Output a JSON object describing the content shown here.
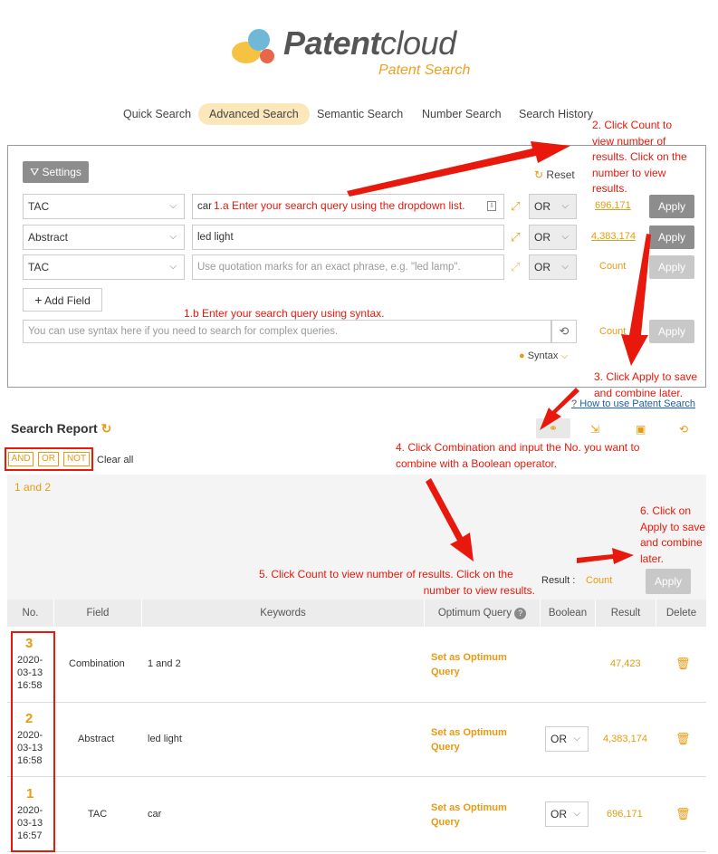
{
  "brand": {
    "name_bold": "Patent",
    "name_thin": "cloud",
    "subtitle": "Patent Search"
  },
  "tabs": [
    {
      "label": "Quick Search"
    },
    {
      "label": "Advanced Search"
    },
    {
      "label": "Semantic Search"
    },
    {
      "label": "Number Search"
    },
    {
      "label": "Search History"
    }
  ],
  "search": {
    "settings_label": "Settings",
    "reset_label": "Reset",
    "rows": [
      {
        "field": "TAC",
        "value": "car",
        "placeholder": "",
        "operator": "OR",
        "count": "696,171",
        "apply": "Apply"
      },
      {
        "field": "Abstract",
        "value": "led light",
        "placeholder": "",
        "operator": "OR",
        "count": "4,383,174",
        "apply": "Apply"
      },
      {
        "field": "TAC",
        "value": "",
        "placeholder": "Use quotation marks for an exact phrase, e.g. \"led lamp\".",
        "operator": "OR",
        "count": "Count",
        "apply": "Apply"
      }
    ],
    "add_field_label": "Add Field",
    "syntax_placeholder": "You can use syntax here if you need to search for complex queries.",
    "syntax_count": "Count",
    "syntax_apply": "Apply",
    "syntax_label": "Syntax",
    "help_link": "How to use Patent Search"
  },
  "annotations": {
    "a1": "1.a Enter your search query using the dropdown list.",
    "a1b": "1.b Enter your search query using syntax.",
    "a2": [
      "2. Click Count to",
      "view number of",
      "results. Click on the",
      "number to view",
      "results."
    ],
    "a3": [
      "3. Click Apply to save",
      "and combine later."
    ],
    "a4": [
      "4. Click Combination and input the No. you want to",
      "combine with a Boolean operator."
    ],
    "a5": [
      "5. Click Count to view number of results. Click on the",
      "number to view results."
    ],
    "a6": [
      "6. Click on",
      "Apply to save",
      "and combine",
      "later."
    ]
  },
  "report": {
    "title": "Search Report",
    "ops": [
      "AND",
      "OR",
      "NOT"
    ],
    "clear_all": "Clear all",
    "combination_text": "1 and 2",
    "result_label": "Result :",
    "result_count": "Count",
    "apply": "Apply",
    "columns": [
      "No.",
      "Field",
      "Keywords",
      "Optimum Query",
      "Boolean",
      "Result",
      "Delete"
    ],
    "rows": [
      {
        "no": "3",
        "date": "2020-",
        "date2": "03-13",
        "time": "16:58",
        "field": "Combination",
        "keywords": "1 and 2",
        "optimum1": "Set as Optimum",
        "optimum2": "Query",
        "boolean": "",
        "result": "47,423"
      },
      {
        "no": "2",
        "date": "2020-",
        "date2": "03-13",
        "time": "16:58",
        "field": "Abstract",
        "keywords": "led light",
        "optimum1": "Set as Optimum",
        "optimum2": "Query",
        "boolean": "OR",
        "result": "4,383,174"
      },
      {
        "no": "1",
        "date": "2020-",
        "date2": "03-13",
        "time": "16:57",
        "field": "TAC",
        "keywords": "car",
        "optimum1": "Set as Optimum",
        "optimum2": "Query",
        "boolean": "OR",
        "result": "696,171"
      }
    ]
  },
  "colors": {
    "accent": "#e89a10",
    "annotation": "#e8190c",
    "active_tab": "#fbe7b9"
  }
}
